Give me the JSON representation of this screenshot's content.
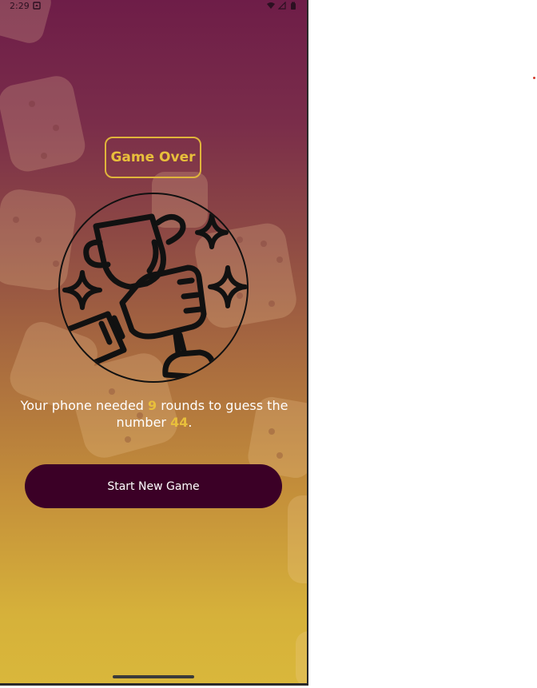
{
  "status_bar": {
    "time": "2:29",
    "notification_icon": "notification-icon",
    "wifi_icon": "wifi-icon",
    "signal_icon": "signal-icon",
    "battery_icon": "battery-icon"
  },
  "screen": {
    "title": "Game Over",
    "image_icon": "trophy-hand-icon",
    "summary": {
      "prefix": "Your phone needed ",
      "rounds": "9",
      "middle": " rounds to guess the number ",
      "number": "44",
      "suffix": "."
    },
    "start_button_label": "Start New Game"
  },
  "colors": {
    "accent": "#e8bf3b",
    "button": "#3b0026",
    "gradient_top": "#6e1d48",
    "gradient_bottom": "#d9b73b"
  }
}
